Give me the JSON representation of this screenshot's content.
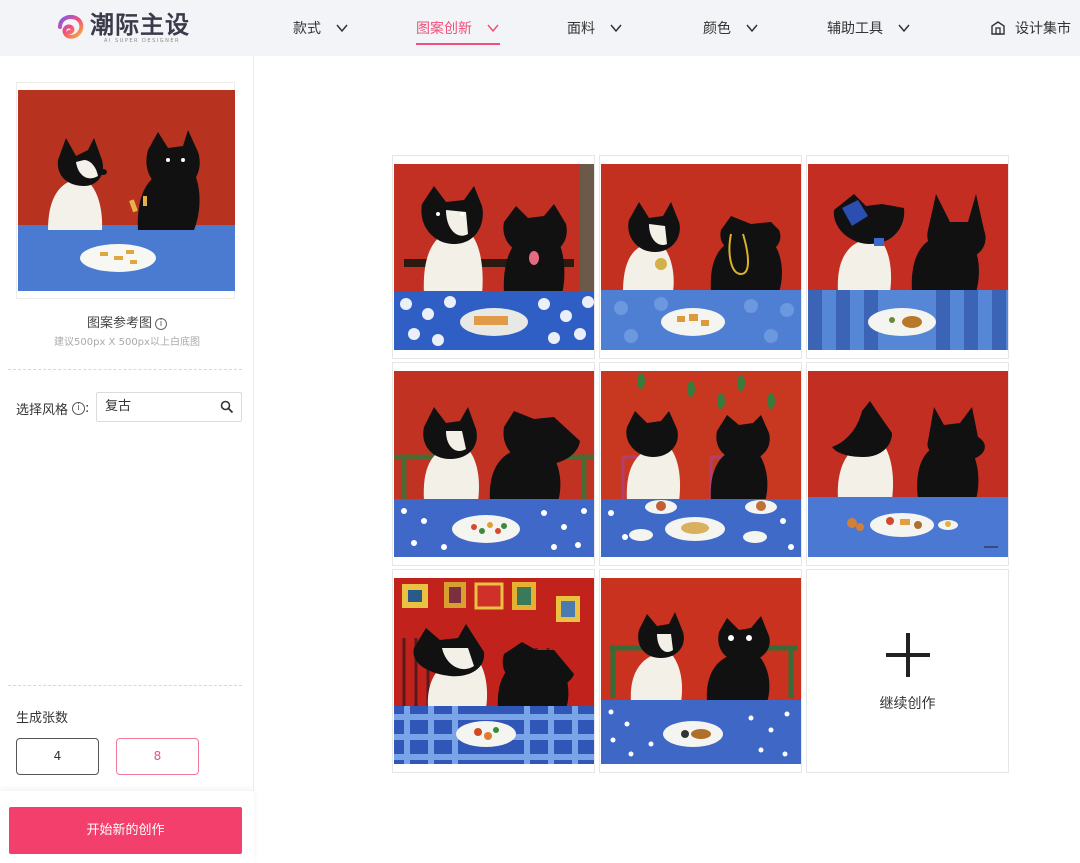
{
  "brand": {
    "name": "潮际主设",
    "subtitle": "AI SUPER DESIGNER"
  },
  "nav": {
    "items": [
      {
        "label": "款式",
        "active": false
      },
      {
        "label": "图案创新",
        "active": true
      },
      {
        "label": "面料",
        "active": false
      },
      {
        "label": "颜色",
        "active": false
      },
      {
        "label": "辅助工具",
        "active": false
      }
    ],
    "market_label": "设计集市"
  },
  "sidebar": {
    "reference_title": "图案参考图",
    "reference_hint": "建议500px X 500px以上白底图",
    "style_label": "选择风格",
    "style_colon": ":",
    "style_value": "复古",
    "count_label": "生成张数",
    "count_options": [
      "4",
      "8"
    ],
    "count_selected": "8",
    "start_button": "开始新的创作"
  },
  "results": {
    "images": [
      "dog-painting-1",
      "dog-painting-2",
      "dog-painting-3",
      "dog-painting-4",
      "dog-painting-5",
      "dog-painting-6",
      "dog-painting-7",
      "dog-painting-8"
    ],
    "continue_label": "继续创作"
  },
  "colors": {
    "accent": "#f0507a",
    "primary_button": "#f23f6b",
    "nav_bg": "#f3f4f7"
  }
}
